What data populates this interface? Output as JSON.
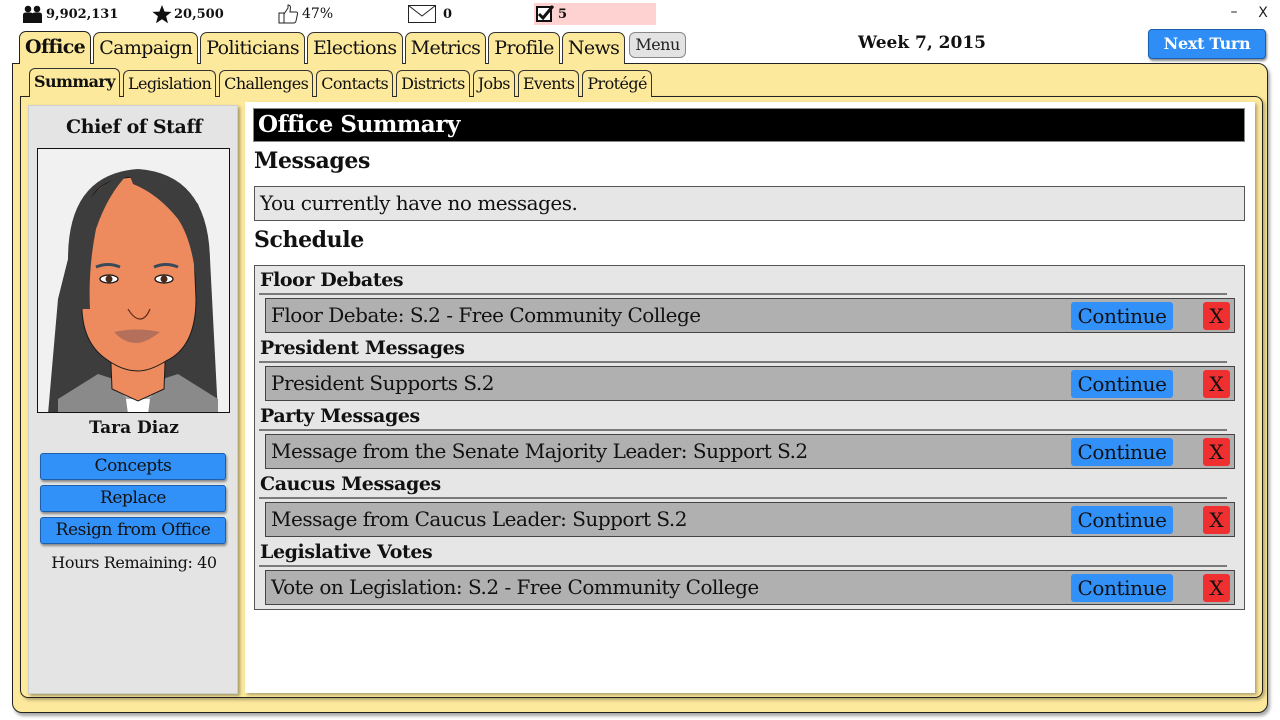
{
  "stats": {
    "population": "9,902,131",
    "fame": "20,500",
    "approval": "47%",
    "mail_count": "0",
    "tasks_count": "5",
    "icons": {
      "population": "people-icon",
      "fame": "star-icon",
      "approval": "thumbs-up-icon",
      "mail": "envelope-icon",
      "tasks": "checkbox-icon"
    },
    "tasks_highlight_color": "#ffd2d2"
  },
  "window": {
    "minimize_label": "–",
    "close_label": "X"
  },
  "main_tabs": [
    {
      "label": "Office",
      "active": true
    },
    {
      "label": "Campaign",
      "active": false
    },
    {
      "label": "Politicians",
      "active": false
    },
    {
      "label": "Elections",
      "active": false
    },
    {
      "label": "Metrics",
      "active": false
    },
    {
      "label": "Profile",
      "active": false
    },
    {
      "label": "News",
      "active": false
    }
  ],
  "menu_label": "Menu",
  "week_label": "Week 7, 2015",
  "next_turn_label": "Next Turn",
  "sub_tabs": [
    {
      "label": "Summary",
      "active": true
    },
    {
      "label": "Legislation",
      "active": false
    },
    {
      "label": "Challenges",
      "active": false
    },
    {
      "label": "Contacts",
      "active": false
    },
    {
      "label": "Districts",
      "active": false
    },
    {
      "label": "Jobs",
      "active": false
    },
    {
      "label": "Events",
      "active": false
    },
    {
      "label": "Protégé",
      "active": false
    }
  ],
  "staff": {
    "title": "Chief of Staff",
    "name": "Tara Diaz",
    "buttons": [
      {
        "label": "Concepts"
      },
      {
        "label": "Replace"
      },
      {
        "label": "Resign from Office"
      }
    ],
    "hours_remaining": "Hours Remaining: 40"
  },
  "summary": {
    "title": "Office Summary",
    "messages_heading": "Messages",
    "messages_text": "You currently have no messages.",
    "schedule_heading": "Schedule",
    "groups": [
      {
        "title": "Floor Debates",
        "items": [
          {
            "text": "Floor Debate: S.2 - Free Community College",
            "continue_label": "Continue",
            "dismiss_label": "X"
          }
        ]
      },
      {
        "title": "President Messages",
        "items": [
          {
            "text": "President Supports S.2",
            "continue_label": "Continue",
            "dismiss_label": "X"
          }
        ]
      },
      {
        "title": "Party Messages",
        "items": [
          {
            "text": "Message from the Senate Majority Leader: Support S.2",
            "continue_label": "Continue",
            "dismiss_label": "X"
          }
        ]
      },
      {
        "title": "Caucus Messages",
        "items": [
          {
            "text": "Message from Caucus Leader: Support S.2",
            "continue_label": "Continue",
            "dismiss_label": "X"
          }
        ]
      },
      {
        "title": "Legislative Votes",
        "items": [
          {
            "text": "Vote on Legislation: S.2 - Free Community College",
            "continue_label": "Continue",
            "dismiss_label": "X"
          }
        ]
      }
    ]
  },
  "colors": {
    "tab_yellow": "#fde99c",
    "button_blue": "#3191f8",
    "dismiss_red": "#f03030",
    "row_gray": "#b0b0b0",
    "panel_gray": "#e4e4e4"
  }
}
